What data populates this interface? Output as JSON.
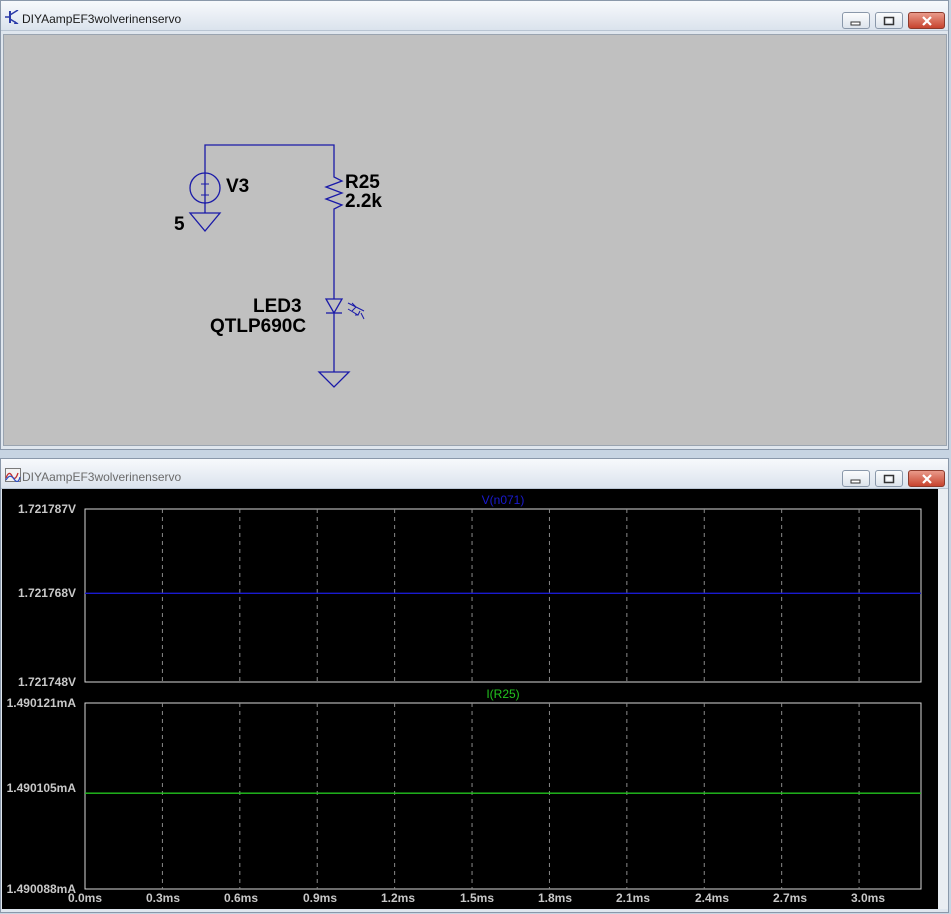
{
  "schematic_window": {
    "title": "DIYAampEF3wolverinenservo",
    "components": {
      "v3_name": "V3",
      "v3_value": "5",
      "r25_name": "R25",
      "r25_value": "2.2k",
      "led3_name": "LED3",
      "led3_model": "QTLP690C"
    }
  },
  "waveform_window": {
    "title": "DIYAampEF3wolverinenservo",
    "top_pane": {
      "trace_label": "V(n071)",
      "y_ticks": [
        "1.721787V",
        "1.721768V",
        "1.721748V"
      ],
      "trace_color": "#1a1ad0"
    },
    "bottom_pane": {
      "trace_label": "I(R25)",
      "y_ticks": [
        "1.490121mA",
        "1.490105mA",
        "1.490088mA"
      ],
      "trace_color": "#22c41e"
    },
    "x_ticks": [
      "0.0ms",
      "0.3ms",
      "0.6ms",
      "0.9ms",
      "1.2ms",
      "1.5ms",
      "1.8ms",
      "2.1ms",
      "2.4ms",
      "2.7ms",
      "3.0ms"
    ]
  },
  "chart_data": [
    {
      "type": "line",
      "title": "V(n071)",
      "x": [
        0.0,
        3.24
      ],
      "series": [
        {
          "name": "V(n071)",
          "values": [
            1.721768,
            1.721768
          ]
        }
      ],
      "xlabel": "",
      "ylabel": "",
      "xlim": [
        0.0,
        3.24
      ],
      "ylim": [
        1.721748,
        1.721787
      ],
      "grid": true
    },
    {
      "type": "line",
      "title": "I(R25)",
      "x": [
        0.0,
        3.24
      ],
      "series": [
        {
          "name": "I(R25)",
          "values": [
            1.490105,
            1.490105
          ]
        }
      ],
      "xlabel": "",
      "ylabel": "",
      "xlim": [
        0.0,
        3.24
      ],
      "ylim": [
        1.490088,
        1.490121
      ],
      "grid": true
    }
  ],
  "colors": {
    "wire": "#1a1aa8",
    "grid": "#8a8a8a",
    "axis_text": "#c8c8c8",
    "canvas_gray": "#c0c0c0"
  },
  "icons": {
    "schematic_app": "transistor-icon",
    "waveform_app": "waveform-icon",
    "minimize": "minimize-icon",
    "maximize": "maximize-icon",
    "close": "close-icon"
  }
}
